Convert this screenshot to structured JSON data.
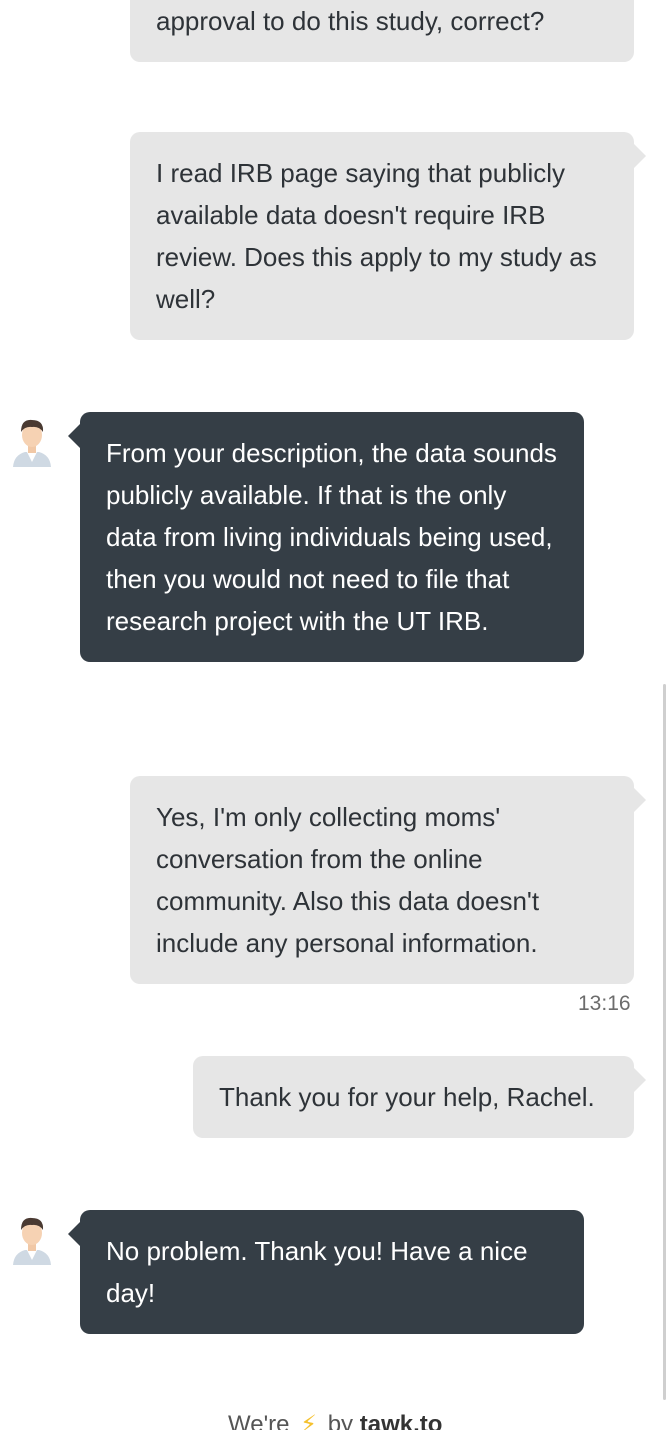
{
  "messages": {
    "m1": {
      "text": "approval to do this study, correct?"
    },
    "m2": {
      "text": "I read IRB page saying that publicly available data doesn't require IRB review.  Does this apply to my study as well?"
    },
    "m3": {
      "text": "From your description, the data sounds publicly available. If that is the only data from living individuals being used, then you would not need to file that research project with the UT IRB."
    },
    "m4": {
      "text": "Yes, I'm only collecting moms' conversation from the online community.  Also this data doesn't include any personal information."
    },
    "m5": {
      "text": "Thank you for your help, Rachel."
    },
    "m6": {
      "text": "No problem. Thank you! Have a nice day!"
    }
  },
  "timestamp": "13:16",
  "footer": {
    "prefix": "We're",
    "middle": "by",
    "brand": "tawk.to"
  },
  "colors": {
    "visitor_bubble": "#e6e6e6",
    "agent_bubble": "#353e46",
    "bolt": "#f5c12e"
  },
  "icons": {
    "avatar": "agent-avatar-icon",
    "bolt": "lightning-bolt-icon"
  }
}
